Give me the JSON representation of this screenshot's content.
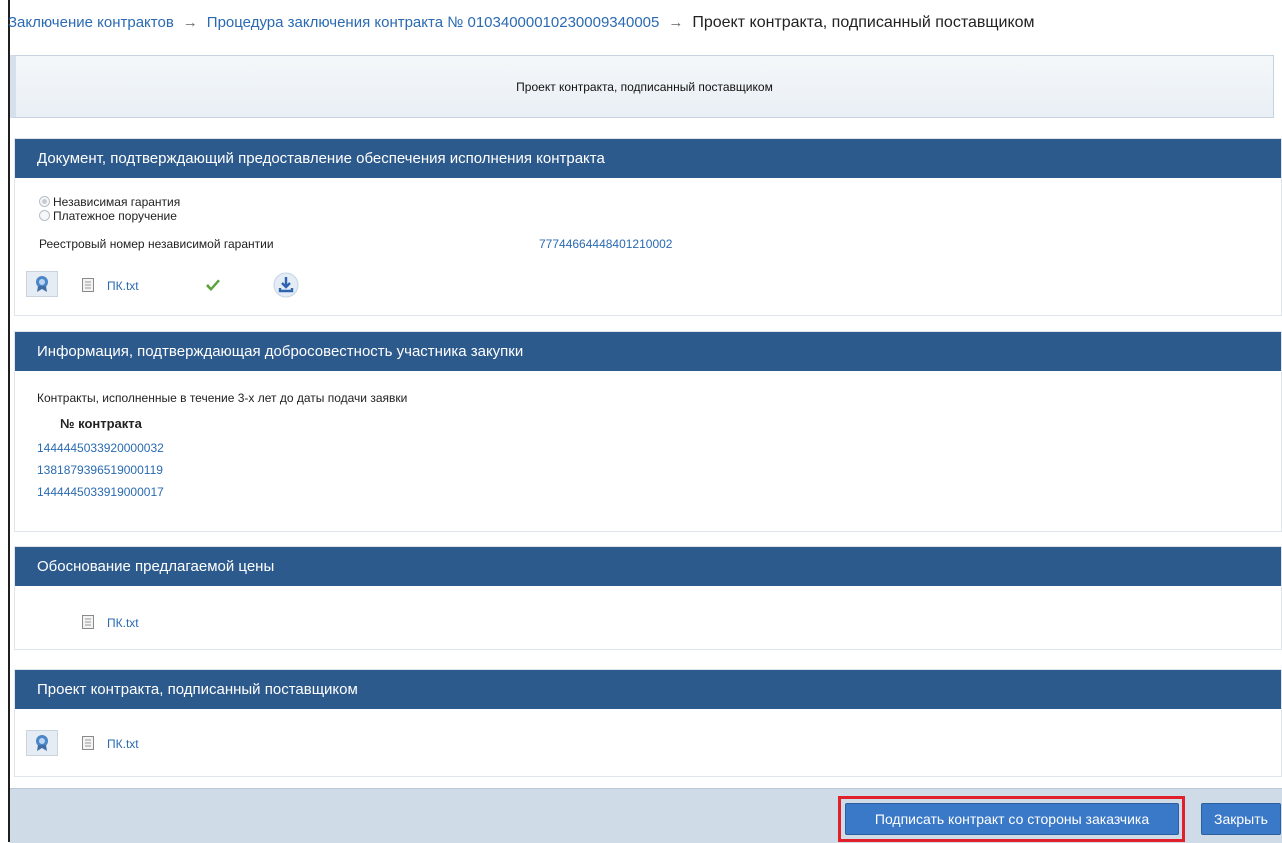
{
  "breadcrumb": {
    "item1": "Заключение контрактов",
    "item2": "Процедура заключения контракта № 0103400001023000934000​5",
    "current": "Проект контракта, подписанный поставщиком",
    "separator": "→"
  },
  "page_title": "Проект контракта, подписанный поставщиком",
  "section_guarantee": {
    "header": "Документ, подтверждающий предоставление обеспечения исполнения контракта",
    "radio_options": [
      "Независимая гарантия",
      "Платежное поручение"
    ],
    "selected": "Независимая гарантия",
    "registry_label": "Реестровый номер независимой гарантии",
    "registry_value": "77744664448401210002",
    "file_name": "ПК.txt",
    "icons": [
      "certificate-icon",
      "document-icon",
      "check-icon",
      "download-icon"
    ]
  },
  "section_integrity": {
    "header": "Информация, подтверждающая добросовестность участника закупки",
    "description": "Контракты, исполненные в течение 3-х лет до даты подачи заявки",
    "column_header": "№ контракта",
    "contracts": [
      "1444445033920000032",
      "1381879396519000119",
      "1444445033919000017"
    ]
  },
  "section_price": {
    "header": "Обоснование предлагаемой цены",
    "file_name": "ПК.txt"
  },
  "section_project": {
    "header": "Проект контракта, подписанный поставщиком",
    "file_name": "ПК.txt"
  },
  "footer": {
    "sign_button": "Подписать контракт со стороны заказчика",
    "close_button": "Закрыть"
  },
  "colors": {
    "header_bg": "#2d5a8c",
    "link": "#2a6ab2",
    "button": "#3a78c8",
    "highlight": "#e2202c"
  }
}
